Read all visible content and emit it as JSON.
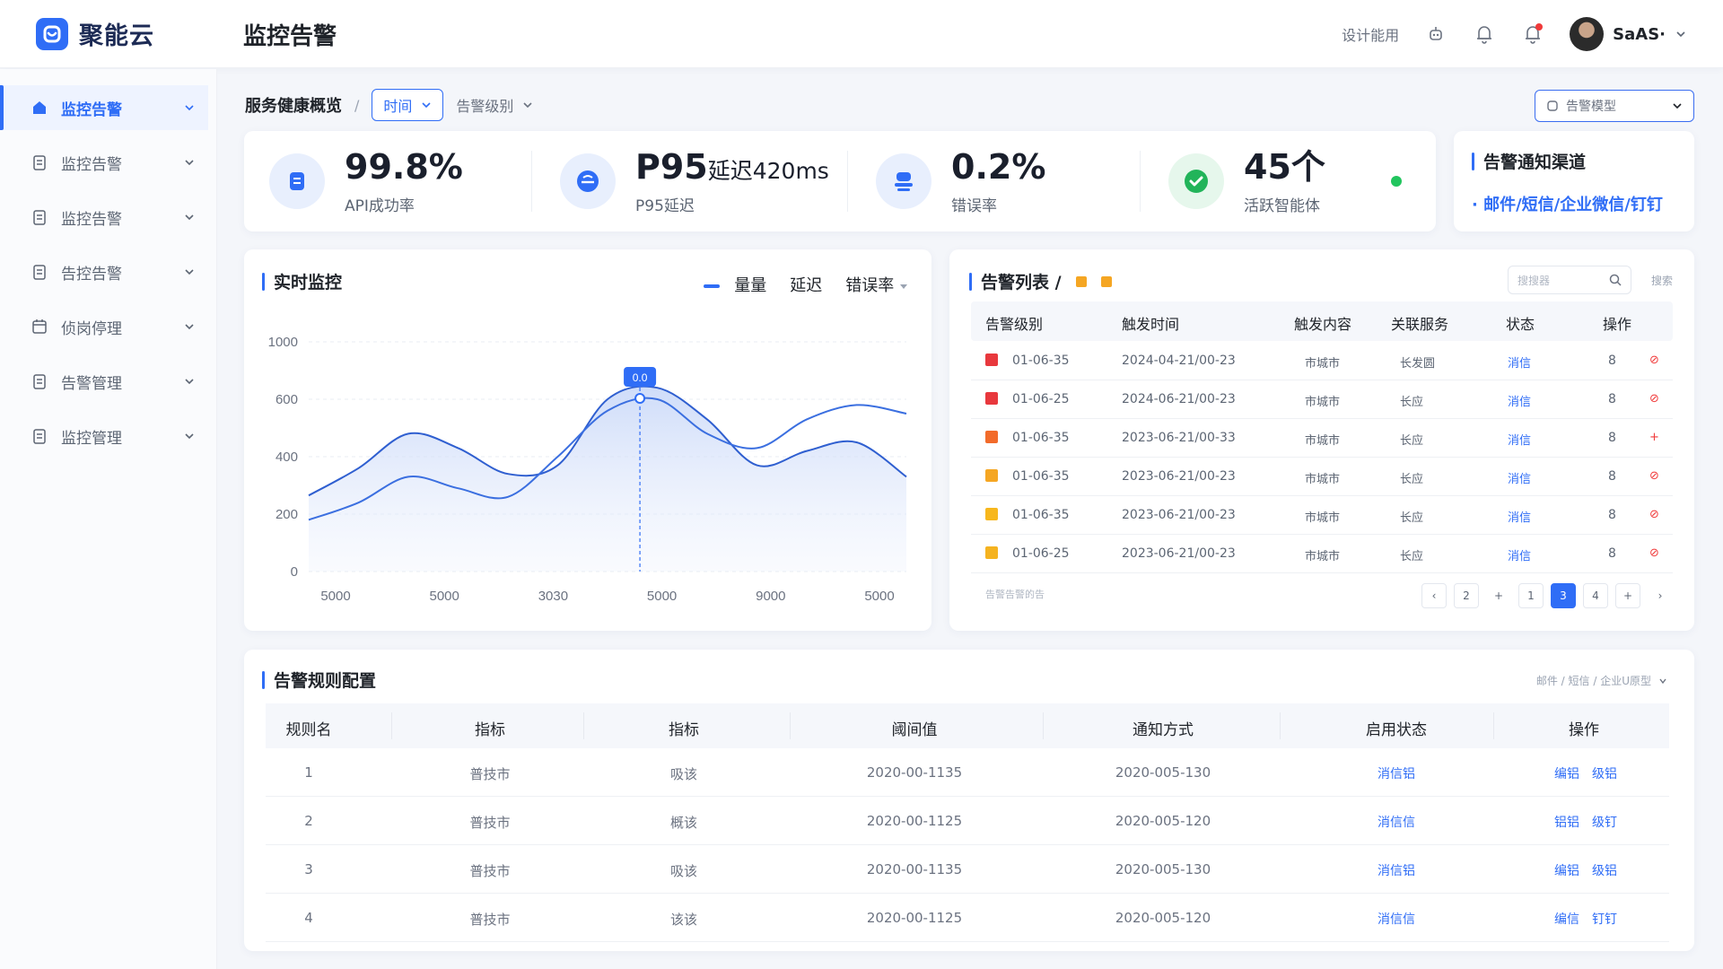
{
  "brand": {
    "name": "聚能云"
  },
  "header": {
    "title": "监控告警",
    "link": "设计能用",
    "user_name": "SaAS·",
    "accent": "#2f6df6"
  },
  "sidebar": {
    "items": [
      {
        "label": "监控告警",
        "icon": "home-icon",
        "active": true
      },
      {
        "label": "监控告警",
        "icon": "document-icon"
      },
      {
        "label": "监控告警",
        "icon": "document-icon"
      },
      {
        "label": "告控告警",
        "icon": "document-icon"
      },
      {
        "label": "侦岗停理",
        "icon": "calendar-icon"
      },
      {
        "label": "告警管理",
        "icon": "document-icon"
      },
      {
        "label": "监控管理",
        "icon": "document-icon"
      }
    ]
  },
  "filters": {
    "breadcrumb": "服务健康概览",
    "separator": "/",
    "time_label": "时间",
    "level_label": "告警级别",
    "alert_type": "告警模型"
  },
  "kpis": [
    {
      "value": "99.8%",
      "suffix": "",
      "label": "API成功率",
      "icon": "document-icon"
    },
    {
      "value": "P95",
      "suffix": "延迟420ms",
      "label": "P95延迟",
      "icon": "gauge-icon"
    },
    {
      "value": "0.2%",
      "suffix": "",
      "label": "错误率",
      "icon": "server-icon"
    },
    {
      "value": "45个",
      "suffix": "",
      "label": "活跃智能体",
      "icon": "check-circle-icon"
    }
  ],
  "notify": {
    "title": "告警通知渠道",
    "channels": "· 邮件/短信/企业微信/钉钉"
  },
  "realtime": {
    "title": "实时监控",
    "legend": [
      "量量",
      "延迟",
      "错误率"
    ]
  },
  "chart_data": {
    "type": "area",
    "title": "实时监控",
    "x": [
      0,
      1,
      2,
      3,
      4,
      5,
      6,
      7,
      8,
      9,
      10,
      11,
      12
    ],
    "x_tick_labels": [
      "5000",
      "5000",
      "3030",
      "5000",
      "9000",
      "5000"
    ],
    "y_tick_labels": [
      "0",
      "200",
      "400",
      "600",
      "1000"
    ],
    "ylim": [
      0,
      800
    ],
    "tooltip_label": "0.0",
    "tooltip_x": 6.65,
    "series": [
      {
        "name": "量量",
        "values": [
          265,
          360,
          480,
          430,
          340,
          370,
          600,
          640,
          530,
          370,
          420,
          450,
          330
        ]
      },
      {
        "name": "延迟",
        "values": [
          180,
          240,
          330,
          290,
          260,
          400,
          560,
          600,
          480,
          430,
          530,
          580,
          550
        ]
      }
    ],
    "grid": true
  },
  "alerts": {
    "title": "告警列表 /",
    "search_placeholder": "搜搜器",
    "search_side": "搜索",
    "columns": [
      "告警级别",
      "触发时间",
      "触发内容",
      "关联服务",
      "状态",
      "操作"
    ],
    "rows": [
      {
        "color": "#e8383d",
        "level": "01-06-35",
        "time": "2024-04-21/00-23",
        "content": "市城市",
        "service": "长发圆",
        "status": "消信",
        "num": "8",
        "action": "⊘"
      },
      {
        "color": "#e8383d",
        "level": "01-06-25",
        "time": "2024-06-21/00-23",
        "content": "市城市",
        "service": "长应",
        "status": "消信",
        "num": "8",
        "action": "⊘"
      },
      {
        "color": "#f26b2a",
        "level": "01-06-35",
        "time": "2023-06-21/00-33",
        "content": "市城市",
        "service": "长应",
        "status": "消信",
        "num": "8",
        "action": "+"
      },
      {
        "color": "#f5a623",
        "level": "01-06-35",
        "time": "2023-06-21/00-23",
        "content": "市城市",
        "service": "长应",
        "status": "消信",
        "num": "8",
        "action": "⊘"
      },
      {
        "color": "#f7b71d",
        "level": "01-06-35",
        "time": "2023-06-21/00-23",
        "content": "市城市",
        "service": "长应",
        "status": "消信",
        "num": "8",
        "action": "⊘"
      },
      {
        "color": "#f5b320",
        "level": "01-06-25",
        "time": "2023-06-21/00-23",
        "content": "市城市",
        "service": "长应",
        "status": "消信",
        "num": "8",
        "action": "⊘"
      }
    ],
    "footnote": "告警告警的告",
    "pager": [
      "‹",
      "2",
      "+",
      "1",
      "3",
      "4",
      "+",
      "›"
    ],
    "current_page": "3"
  },
  "rules": {
    "title": "告警规则配置",
    "right_text": "邮件 / 短信 / 企业U原型",
    "columns": [
      "规则名",
      "指标",
      "指标",
      "阈间值",
      "通知方式",
      "启用状态",
      "操作"
    ],
    "rows": [
      {
        "name": "1",
        "m1": "普技市",
        "m2": "吸该",
        "threshold": "2020-00-1135",
        "notify": "2020-005-130",
        "status": "消信铝",
        "op1": "编铝",
        "op2": "级铝"
      },
      {
        "name": "2",
        "m1": "普技市",
        "m2": "概该",
        "threshold": "2020-00-1125",
        "notify": "2020-005-120",
        "status": "消信信",
        "op1": "铝铝",
        "op2": "级钉"
      },
      {
        "name": "3",
        "m1": "普技市",
        "m2": "吸该",
        "threshold": "2020-00-1135",
        "notify": "2020-005-130",
        "status": "消信铝",
        "op1": "编铝",
        "op2": "级铝"
      },
      {
        "name": "4",
        "m1": "普技市",
        "m2": "该该",
        "threshold": "2020-00-1125",
        "notify": "2020-005-120",
        "status": "消信信",
        "op1": "编信",
        "op2": "钉钉"
      }
    ]
  }
}
